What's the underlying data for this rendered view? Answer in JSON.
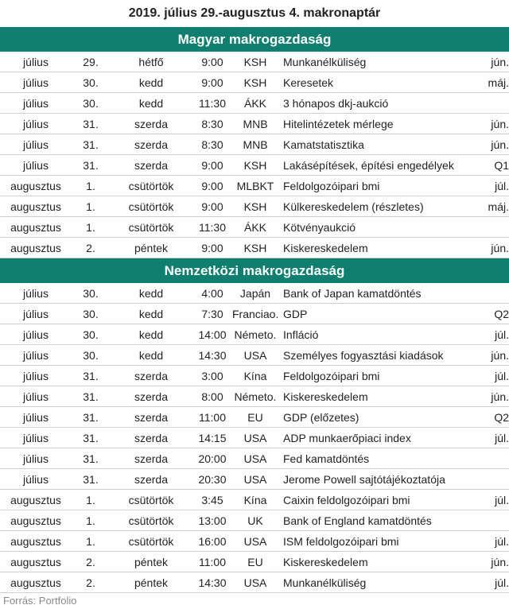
{
  "title": "2019. július 29.-augusztus 4. makronaptár",
  "sections": [
    {
      "heading": "Magyar makrogazdaság",
      "rows": [
        [
          "július",
          "29.",
          "hétfő",
          "9:00",
          "KSH",
          "Munkanélküliség",
          "jún."
        ],
        [
          "július",
          "30.",
          "kedd",
          "9:00",
          "KSH",
          "Keresetek",
          "máj."
        ],
        [
          "július",
          "30.",
          "kedd",
          "11:30",
          "ÁKK",
          "3 hónapos dkj-aukció",
          ""
        ],
        [
          "július",
          "31.",
          "szerda",
          "8:30",
          "MNB",
          "Hitelintézetek mérlege",
          "jún."
        ],
        [
          "július",
          "31.",
          "szerda",
          "8:30",
          "MNB",
          "Kamatstatisztika",
          "jún."
        ],
        [
          "július",
          "31.",
          "szerda",
          "9:00",
          "KSH",
          "Lakásépítések, építési engedélyek",
          "Q1"
        ],
        [
          "augusztus",
          "1.",
          "csütörtök",
          "9:00",
          "MLBKT",
          "Feldolgozóipari bmi",
          "júl."
        ],
        [
          "augusztus",
          "1.",
          "csütörtök",
          "9:00",
          "KSH",
          "Külkereskedelem (részletes)",
          "máj."
        ],
        [
          "augusztus",
          "1.",
          "csütörtök",
          "11:30",
          "ÁKK",
          "Kötvényaukció",
          ""
        ],
        [
          "augusztus",
          "2.",
          "péntek",
          "9:00",
          "KSH",
          "Kiskereskedelem",
          "jún."
        ]
      ]
    },
    {
      "heading": "Nemzetközi makrogazdaság",
      "rows": [
        [
          "július",
          "30.",
          "kedd",
          "4:00",
          "Japán",
          "Bank of Japan kamatdöntés",
          ""
        ],
        [
          "július",
          "30.",
          "kedd",
          "7:30",
          "Franciao.",
          "GDP",
          "Q2"
        ],
        [
          "július",
          "30.",
          "kedd",
          "14:00",
          "Németo.",
          "Infláció",
          "júl."
        ],
        [
          "július",
          "30.",
          "kedd",
          "14:30",
          "USA",
          "Személyes fogyasztási kiadások",
          "jún."
        ],
        [
          "július",
          "31.",
          "szerda",
          "3:00",
          "Kína",
          "Feldolgozóipari bmi",
          "júl."
        ],
        [
          "július",
          "31.",
          "szerda",
          "8:00",
          "Németo.",
          "Kiskereskedelem",
          "jún."
        ],
        [
          "július",
          "31.",
          "szerda",
          "11:00",
          "EU",
          "GDP (előzetes)",
          "Q2"
        ],
        [
          "július",
          "31.",
          "szerda",
          "14:15",
          "USA",
          "ADP munkaerőpiaci index",
          "júl."
        ],
        [
          "július",
          "31.",
          "szerda",
          "20:00",
          "USA",
          "Fed kamatdöntés",
          ""
        ],
        [
          "július",
          "31.",
          "szerda",
          "20:30",
          "USA",
          "Jerome Powell sajtótájékoztatója",
          ""
        ],
        [
          "augusztus",
          "1.",
          "csütörtök",
          "3:45",
          "Kína",
          "Caixin feldolgozóipari bmi",
          "júl."
        ],
        [
          "augusztus",
          "1.",
          "csütörtök",
          "13:00",
          "UK",
          "Bank of England kamatdöntés",
          ""
        ],
        [
          "augusztus",
          "1.",
          "csütörtök",
          "16:00",
          "USA",
          "ISM feldolgozóipari bmi",
          "júl."
        ],
        [
          "augusztus",
          "2.",
          "péntek",
          "11:00",
          "EU",
          "Kiskereskedelem",
          "jún."
        ],
        [
          "augusztus",
          "2.",
          "péntek",
          "14:30",
          "USA",
          "Munkanélküliség",
          "júl."
        ]
      ]
    }
  ],
  "source": "Forrás: Portfolio",
  "colors": {
    "section_bg": "#117f6f",
    "section_text": "#ffffff",
    "row_border": "#cfcfcf",
    "source_text": "#8a8a8a"
  }
}
